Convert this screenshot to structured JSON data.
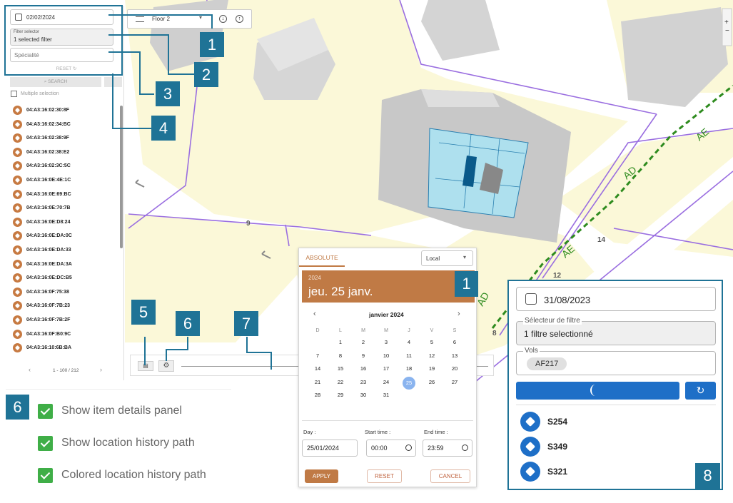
{
  "sidebar": {
    "date_value": "02/02/2024",
    "floor_label": "Floor 2",
    "filter_selector_label": "Filter selector",
    "filter_selector_value": "1 selected filter",
    "specialty_placeholder": "Spécialité",
    "reset_label": "RESET",
    "search_label": "SEARCH",
    "multiple_selection_label": "Multiple selection",
    "items": [
      "04:A3:16:02:30:8F",
      "04:A3:16:02:34:BC",
      "04:A3:16:02:38:9F",
      "04:A3:16:02:38:E2",
      "04:A3:16:02:3C:5C",
      "04:A3:16:0E:4E:1C",
      "04:A3:16:0E:69:BC",
      "04:A3:16:0E:70:7B",
      "04:A3:16:0E:D8:24",
      "04:A3:16:0E:DA:0C",
      "04:A3:16:0E:DA:33",
      "04:A3:16:0E:DA:3A",
      "04:A3:16:0E:DC:B5",
      "04:A3:16:0F:75:38",
      "04:A3:16:0F:7B:23",
      "04:A3:16:0F:7B:2F",
      "04:A3:16:0F:B0:9C",
      "04:A3:16:10:6B:BA"
    ],
    "pagination": "1 - 100 / 212",
    "prev_icon": "chevron-left-icon",
    "next_icon": "chevron-right-icon"
  },
  "map": {
    "labels": [
      "9",
      "14",
      "12",
      "8",
      "AD",
      "AE",
      "AE",
      "AD"
    ],
    "colors": {
      "parcel_fill": "#fbf8d8",
      "parcel_line": "#9a6ee0",
      "building_fill": "#dcdcdc",
      "floor_plan": "#aee0ee",
      "path_line": "#2e8b1e"
    }
  },
  "callouts": [
    "1",
    "2",
    "3",
    "4",
    "5",
    "6",
    "7",
    "1",
    "6",
    "8"
  ],
  "calendar": {
    "tab_label": "ABSOLUTE",
    "tz_value": "Local",
    "year": "2024",
    "headline": "jeu. 25 janv.",
    "month_label": "janvier 2024",
    "weekdays": [
      "D",
      "L",
      "M",
      "M",
      "J",
      "V",
      "S"
    ],
    "days": [
      "1",
      "2",
      "3",
      "4",
      "5",
      "6",
      "7",
      "8",
      "9",
      "10",
      "11",
      "12",
      "13",
      "14",
      "15",
      "16",
      "17",
      "18",
      "19",
      "20",
      "21",
      "22",
      "23",
      "24",
      "25",
      "26",
      "27",
      "28",
      "29",
      "30",
      "31"
    ],
    "selected_day": "25",
    "day_label": "Day :",
    "day_value": "25/01/2024",
    "start_label": "Start time :",
    "start_value": "00:00",
    "end_label": "End time :",
    "end_value": "23:59",
    "apply_label": "APPLY",
    "reset_label": "RESET",
    "cancel_label": "CANCEL",
    "accent_color": "#c07a45"
  },
  "right_panel": {
    "date_value": "31/08/2023",
    "filter_label": "Sélecteur de filtre",
    "filter_value": "1 filtre selectionné",
    "vols_label": "Vols",
    "chip": "AF217",
    "items": [
      "S254",
      "S349",
      "S321"
    ],
    "accent_color": "#1e6fc7"
  },
  "options": {
    "items": [
      "Show item details panel",
      "Show location history path",
      "Colored location history path"
    ],
    "check_color": "#3fae47"
  }
}
